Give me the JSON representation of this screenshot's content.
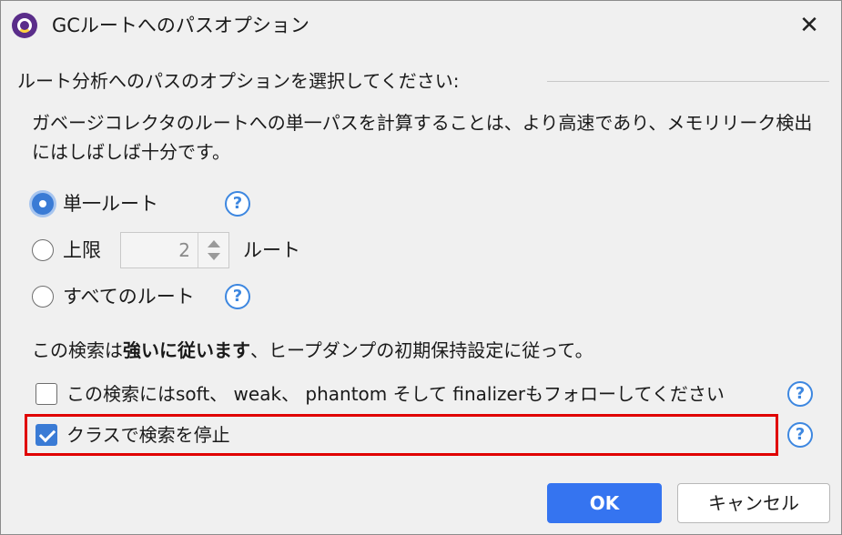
{
  "window": {
    "title": "GCルートへのパスオプション",
    "close_glyph": "✕"
  },
  "section": {
    "heading": "ルート分析へのパスのオプションを選択してください:"
  },
  "description": "ガベージコレクタのルートへの単一パスを計算することは、より高速であり、メモリリーク検出にはしばしば十分です。",
  "options": {
    "single_root": {
      "label": "単一ルート",
      "selected": true
    },
    "max_roots": {
      "label": "上限",
      "value": "2",
      "suffix": "ルート",
      "selected": false
    },
    "all_roots": {
      "label": "すべてのルート",
      "selected": false
    }
  },
  "note": {
    "prefix": "この検索は",
    "bold": "強いに従います",
    "suffix": "、ヒープダンプの初期保持設定に従って。"
  },
  "checkboxes": {
    "follow_weak": {
      "label": "この検索にはsoft、 weak、 phantom そして finalizerもフォローしてください",
      "checked": false
    },
    "stop_at_class": {
      "label": "クラスで検索を停止",
      "checked": true
    }
  },
  "help_glyph": "?",
  "buttons": {
    "ok": "OK",
    "cancel": "キャンセル"
  },
  "colors": {
    "accent": "#3574f0",
    "highlight_border": "#e00000",
    "help": "#3d87e0"
  }
}
